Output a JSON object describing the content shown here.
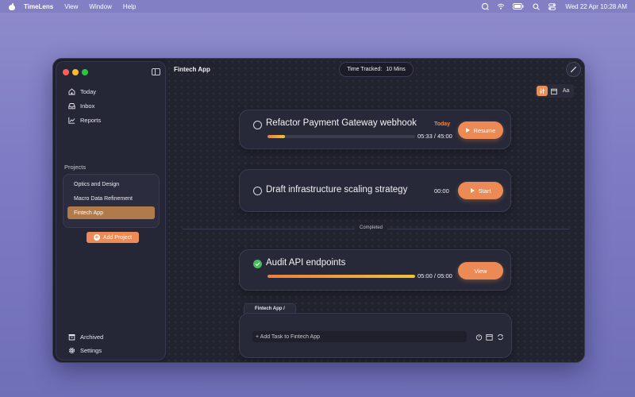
{
  "menubar": {
    "app_name": "TimeLens",
    "items": [
      "View",
      "Window",
      "Help"
    ],
    "datetime": "Wed 22 Apr  10:28 AM"
  },
  "sidebar": {
    "nav": [
      {
        "label": "Today",
        "icon": "home-icon"
      },
      {
        "label": "Inbox",
        "icon": "inbox-icon"
      },
      {
        "label": "Reports",
        "icon": "chart-icon"
      }
    ],
    "projects_label": "Projects",
    "projects": [
      {
        "label": "Optics and Design",
        "active": false
      },
      {
        "label": "Macro Data Refinement",
        "active": false
      },
      {
        "label": "Fintech App",
        "active": true
      }
    ],
    "add_project": "Add Project",
    "archived": "Archived",
    "settings": "Settings"
  },
  "header": {
    "title": "Fintech App",
    "time_tracked_label": "Time Tracked:",
    "time_tracked_value": "10 Mins"
  },
  "view_toggle": {
    "options": [
      "sliders-icon",
      "calendar-icon",
      "Aa"
    ],
    "active_index": 0
  },
  "tasks": [
    {
      "title": "Refactor Payment Gateway webhook",
      "badge": "Today",
      "timer": "05:33 / 45:00",
      "progress": 0.12,
      "button": "Resume",
      "completed": false
    },
    {
      "title": "Draft infrastructure scaling strategy",
      "timer": "00:00",
      "button": "Start",
      "completed": false
    }
  ],
  "completed_label": "Completed",
  "completed_tasks": [
    {
      "title": "Audit API endpoints",
      "timer": "05:00 / 05:00",
      "progress": 1.0,
      "button": "View",
      "completed": true
    }
  ],
  "composer": {
    "tab": "Fintech App /",
    "placeholder": "+ Add Task to Fintech App"
  },
  "colors": {
    "accent": "#ec8a55",
    "active_project": "#b07a4a",
    "today_badge": "#ec8a4e",
    "check_done": "#40c057",
    "progress_start": "#ec7f3f",
    "progress_end": "#f2c13a"
  }
}
